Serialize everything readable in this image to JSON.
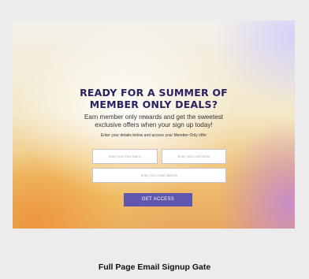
{
  "gate": {
    "headline_line1": "READY FOR A SUMMER OF",
    "headline_line2": "MEMBER ONLY DEALS?",
    "sub_line1": "Earn member only rewards and get the sweetest",
    "sub_line2": "exclusive offers when your sign up today!",
    "hint": "Enter your details below and access your Member-Only offer",
    "first_name_placeholder": "Enter your First Name",
    "last_name_placeholder": "Enter your Last Name",
    "email_placeholder": "Enter your email address",
    "cta_label": "GET ACCESS"
  },
  "caption": "Full Page Email Signup Gate",
  "colors": {
    "headline": "#2c2160",
    "cta_background": "#5f56ad",
    "page_background": "#ececec"
  }
}
